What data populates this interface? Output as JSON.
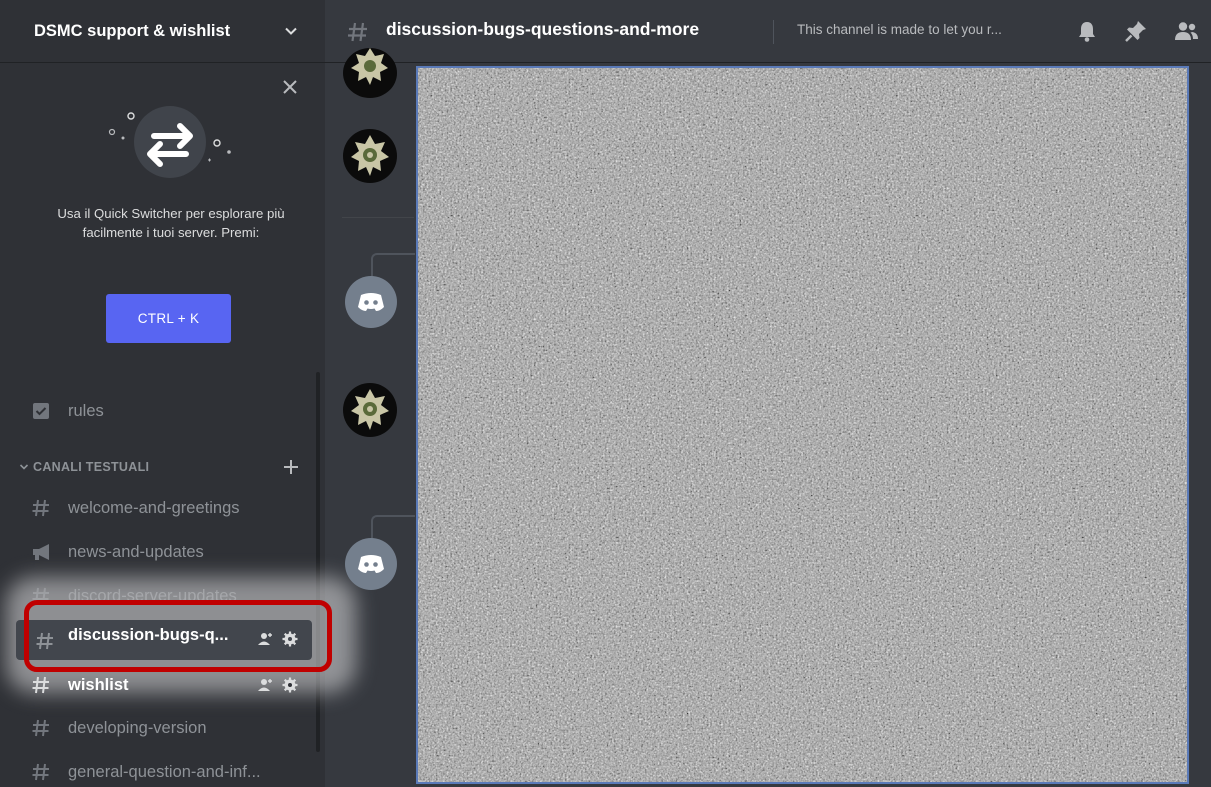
{
  "server": {
    "name": "DSMC support & wishlist"
  },
  "quick_switcher": {
    "text": "Usa il Quick Switcher per esplorare più facilmente i tuoi server. Premi:",
    "shortcut": "CTRL + K"
  },
  "channels": {
    "rules": "rules",
    "category": "CANALI TESTUALI",
    "items": [
      {
        "label": "welcome-and-greetings"
      },
      {
        "label": "news-and-updates"
      },
      {
        "label": "discord-server-updates"
      },
      {
        "label": "discussion-bugs-q..."
      },
      {
        "label": "wishlist"
      },
      {
        "label": "developing-version"
      },
      {
        "label": "general-question-and-inf..."
      }
    ]
  },
  "topbar": {
    "channel_name": "discussion-bugs-questions-and-more",
    "topic": "This channel is made to let you r..."
  },
  "colors": {
    "accent": "#5865f2",
    "highlight": "#c00000"
  }
}
